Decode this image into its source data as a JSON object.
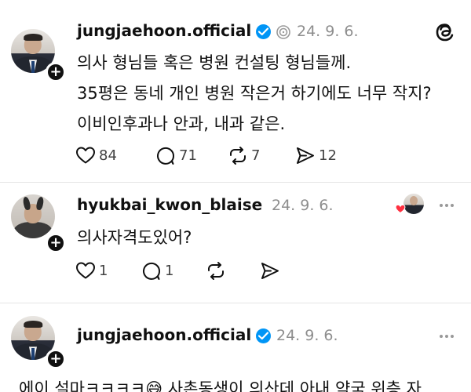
{
  "posts": [
    {
      "username": "jungjaehoon.official",
      "verified": true,
      "date": "24. 9. 6.",
      "lines": [
        "의사 형님들 혹은 병원 컨설팅 형님들께.",
        "35평은 동네 개인 병원 작은거 하기에도 너무 작지?",
        "이비인후과나 안과, 내과 같은."
      ],
      "likes": "84",
      "replies": "71",
      "reposts": "7",
      "shares": "12"
    },
    {
      "username": "hyukbai_kwon_blaise",
      "date": "24. 9. 6.",
      "lines": [
        "의사자격도있어?"
      ],
      "likes": "1",
      "replies": "1"
    },
    {
      "username": "jungjaehoon.official",
      "verified": true,
      "date": "24. 9. 6.",
      "lines": [
        "에이 설마ㅋㅋㅋㅋ😅 사촌동생이 의산데 아내 약국 위층 자"
      ]
    }
  ],
  "icons": {
    "threads_logo": "threads-logo-icon",
    "like": "heart-icon",
    "reply": "comment-icon",
    "repost": "repost-icon",
    "share": "send-icon",
    "more": "more-icon"
  },
  "colors": {
    "verified": "#0095f6",
    "liked": "#ff3040"
  }
}
